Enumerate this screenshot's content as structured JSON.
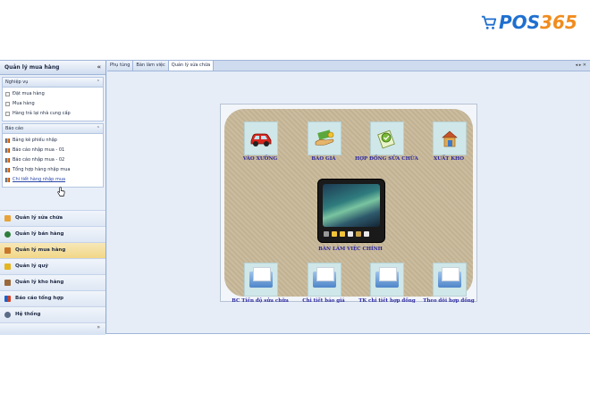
{
  "brand": {
    "logo_text_a": "POS",
    "logo_text_b": "365"
  },
  "sidebar": {
    "title": "Quản lý mua hàng",
    "groups": [
      {
        "title": "Nghiệp vụ",
        "items": [
          "Đặt mua hàng",
          "Mua hàng",
          "Hàng trả lại nhà cung cấp"
        ]
      },
      {
        "title": "Báo cáo",
        "items": [
          "Bảng kê phiếu nhập",
          "Báo cáo nhập mua - 01",
          "Báo cáo nhập mua - 02",
          "Tổng hợp hàng nhập mua",
          "Chi tiết hàng nhập mua"
        ]
      }
    ],
    "nav": [
      "Quản lý sửa chữa",
      "Quản lý bán hàng",
      "Quản lý mua hàng",
      "Quản lý quỹ",
      "Quản lý kho hàng",
      "Báo cáo tổng hợp",
      "Hệ thống"
    ],
    "active_nav": "Quản lý mua hàng",
    "footer_chevron": "»"
  },
  "tabs": [
    "Phụ tùng",
    "Bàn làm việc",
    "Quản lý sửa chữa"
  ],
  "active_tab": "Quản lý sửa chữa",
  "tab_controls": "◂ ▸ ✕",
  "desk": {
    "top_items": [
      "VÀO XƯỞNG",
      "BÁO GIÁ",
      "HỢP ĐỒNG SỬA CHỮA",
      "XUẤT KHO"
    ],
    "center_label": "BÀN LÀM VIỆC CHÍNH",
    "bottom_items": [
      "BC Tiến độ sửa chữa",
      "Chi tiết báo giá",
      "TK chi tiết hợp đồng",
      "Theo dõi hợp đồng"
    ]
  }
}
